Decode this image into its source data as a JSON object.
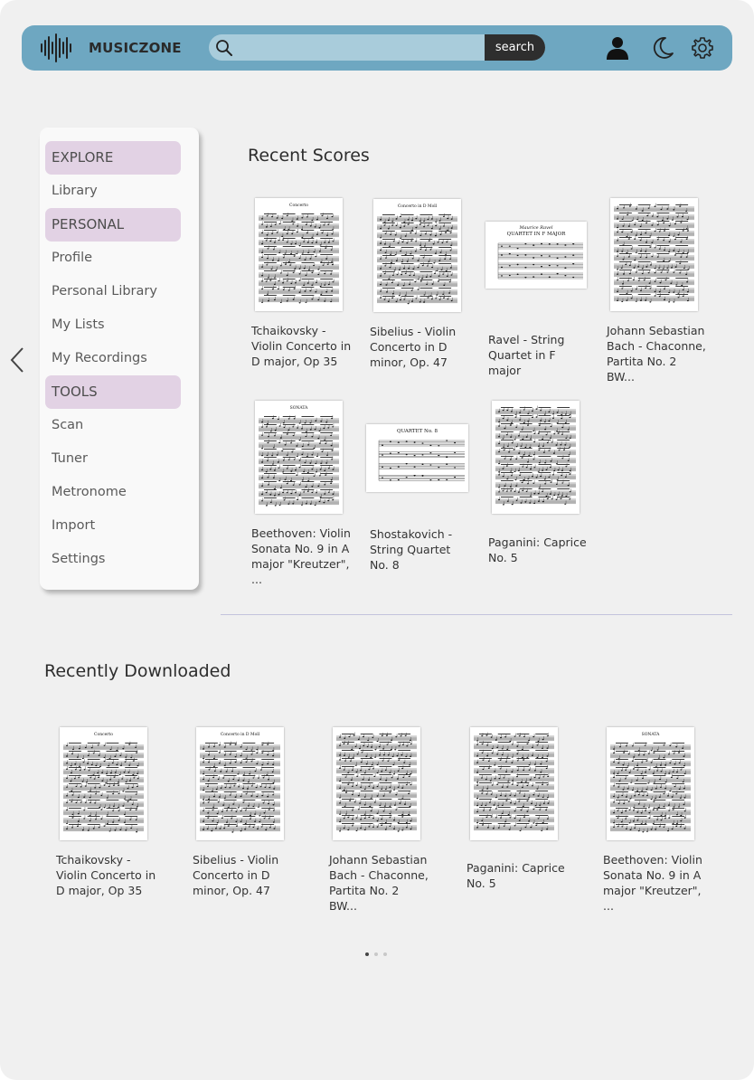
{
  "header": {
    "app_name": "MUSICZONE",
    "search": {
      "placeholder": "",
      "value": "",
      "button_label": "search"
    }
  },
  "sidebar": {
    "sections": [
      {
        "label": "EXPLORE",
        "items": [
          "Library"
        ]
      },
      {
        "label": "PERSONAL",
        "items": [
          "Profile",
          "Personal Library",
          "My Lists",
          "My Recordings"
        ]
      },
      {
        "label": "TOOLS",
        "items": [
          "Scan",
          "Tuner",
          "Metronome",
          "Import",
          "Settings"
        ]
      }
    ]
  },
  "recent_scores": {
    "title": "Recent Scores",
    "items": [
      {
        "title": "Tchaikovsky - Violin Concerto in D major, Op 35",
        "cover_text": "Concerto"
      },
      {
        "title": "Sibelius - Violin Concerto in D minor, Op. 47",
        "cover_text": "Concerto in D Moll"
      },
      {
        "title": "Ravel - String Quartet in F major",
        "cover_text": "QUARTET IN F MAJOR",
        "cover_composer": "Maurice Ravel"
      },
      {
        "title": "Johann Sebastian Bach - Chaconne, Partita No. 2 BW...",
        "cover_text": ""
      },
      {
        "title": "Beethoven: Violin Sonata No. 9 in A major \"Kreutzer\", ...",
        "cover_text": "SONATA"
      },
      {
        "title": "Shostakovich - String Quartet No. 8",
        "cover_text": "QUARTET No. 8"
      },
      {
        "title": "Paganini: Caprice No. 5",
        "cover_text": ""
      }
    ]
  },
  "recently_downloaded": {
    "title": "Recently Downloaded",
    "items": [
      {
        "title": "Tchaikovsky - Violin Concerto in D major, Op 35"
      },
      {
        "title": "Sibelius - Violin Concerto in D minor, Op. 47"
      },
      {
        "title": "Johann Sebastian Bach - Chaconne, Partita No. 2 BW..."
      },
      {
        "title": "Paganini: Caprice No. 5"
      },
      {
        "title": "Beethoven: Violin Sonata No. 9 in A major \"Kreutzer\", ..."
      }
    ]
  },
  "pagination": {
    "pages": 3,
    "current": 1
  },
  "colors": {
    "header_bg": "#6ea7c1",
    "search_bg": "#a9ccdb",
    "section_highlight": "#e2d2e4",
    "page_bg": "#f0f0f0"
  },
  "icons": [
    "logo-waveform-icon",
    "search-icon",
    "user-icon",
    "moon-icon",
    "gear-icon",
    "chevron-left-icon"
  ]
}
